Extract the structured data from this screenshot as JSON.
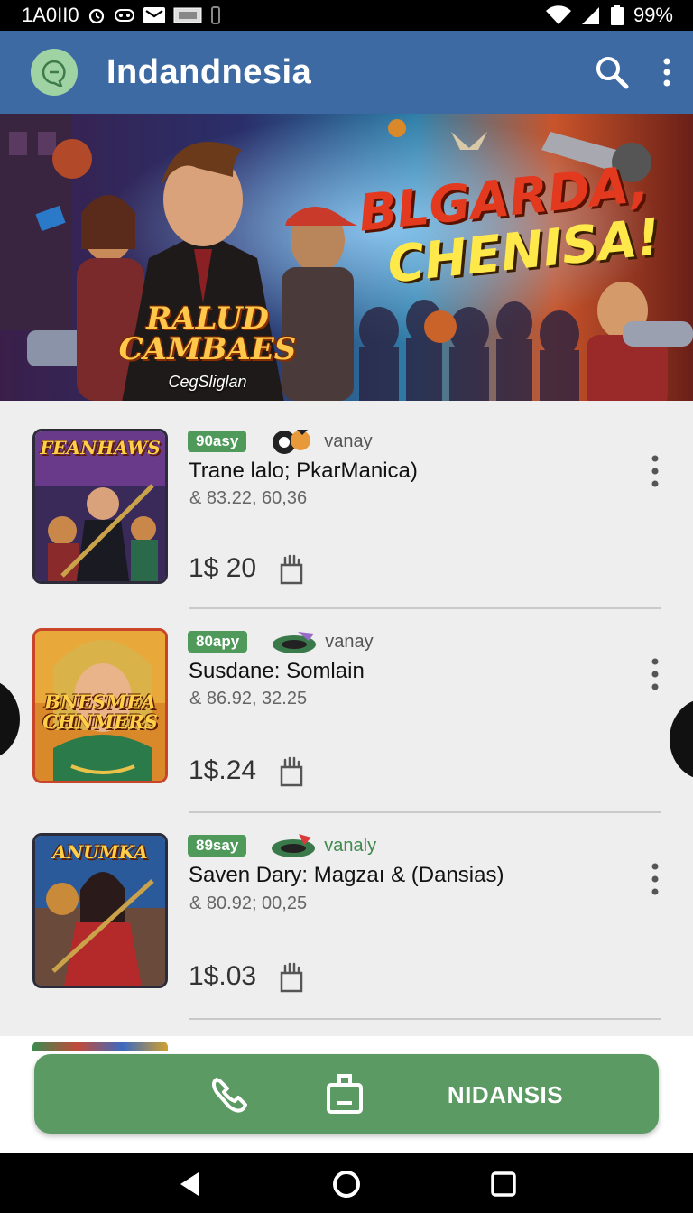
{
  "status_bar": {
    "left_text": "1A0II0",
    "battery": "99%"
  },
  "app_bar": {
    "title": "Indandnesia",
    "icons": [
      "chat-logo-icon",
      "search-icon",
      "more-vert-icon"
    ]
  },
  "banner": {
    "logo_title": "RALUD CAMBAES",
    "logo_subtitle": "CegSliglan",
    "headline_line1": "BLGARDA,",
    "headline_line2": "CHENISA!"
  },
  "items": [
    {
      "thumb_title": "FEANHAWS",
      "badge": "90asy",
      "brand": "vanay",
      "title": "Trane lalo; PkarManica)",
      "stats": "& 83.22,  60,36",
      "price": "1$ 20"
    },
    {
      "thumb_title": "BNESMEA CHNMERS",
      "badge": "80apy",
      "brand": "vanay",
      "title": "Susdane: Somlain",
      "stats": "& 86.92,  32.25",
      "price": "1$.24"
    },
    {
      "thumb_title": "ANUMKA",
      "badge": "89say",
      "brand": "vanaly",
      "title": "Saven Dary: Magzaı & (Dansias)",
      "stats": "& 80.92;  00,25",
      "price": "1$.03"
    }
  ],
  "action_bar": {
    "label": "NIDANSIS",
    "icons": [
      "phone-icon",
      "clipboard-icon"
    ]
  },
  "nav_bar": {
    "icons": [
      "back-icon",
      "home-icon",
      "recents-icon"
    ]
  },
  "colors": {
    "app_bar": "#3e6aa3",
    "accent_green": "#5b9a63",
    "badge_green": "#4f9a5b"
  }
}
